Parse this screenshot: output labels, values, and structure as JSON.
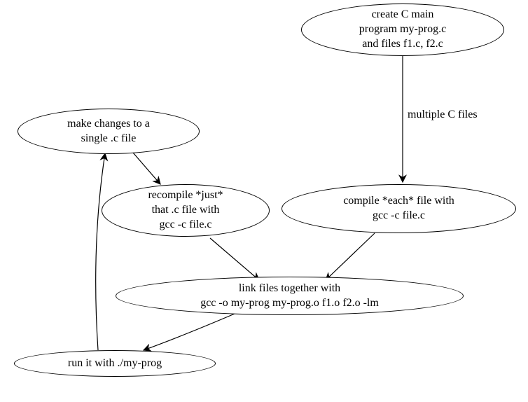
{
  "diagram": {
    "nodes": {
      "create": "create C main\nprogram my-prog.c\nand files f1.c, f2.c",
      "make_changes": "make changes to a\nsingle .c file",
      "recompile": "recompile *just*\nthat .c file with\ngcc -c file.c",
      "compile_each": "compile *each* file with\ngcc -c file.c",
      "link": "link files together with\ngcc -o my-prog my-prog.o f1.o f2.o -lm",
      "run": "run it with ./my-prog"
    },
    "edge_labels": {
      "multiple_files": "multiple C files"
    },
    "edges": [
      {
        "from": "create",
        "to": "compile_each",
        "label": "multiple C files"
      },
      {
        "from": "compile_each",
        "to": "link"
      },
      {
        "from": "recompile",
        "to": "link"
      },
      {
        "from": "link",
        "to": "run"
      },
      {
        "from": "run",
        "to": "make_changes"
      },
      {
        "from": "make_changes",
        "to": "recompile"
      }
    ]
  }
}
